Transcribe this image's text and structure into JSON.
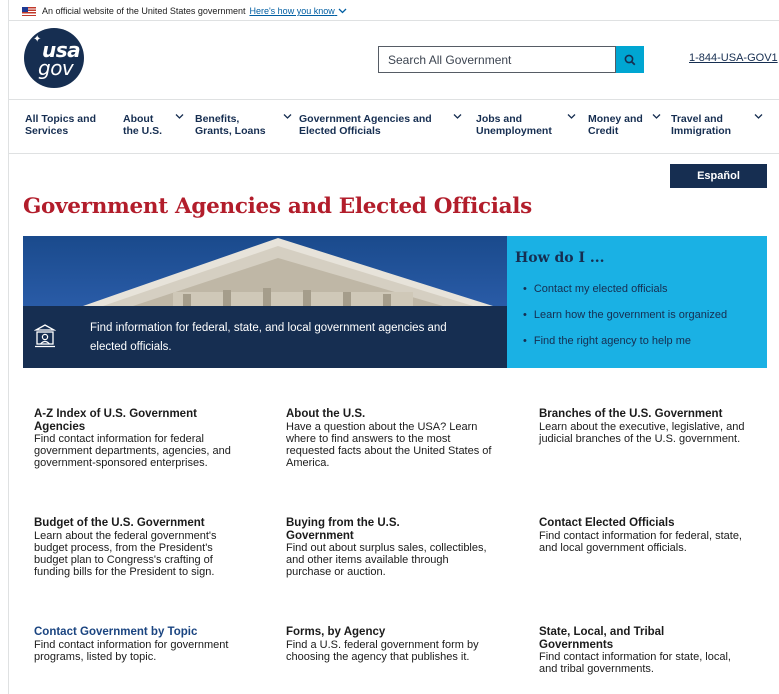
{
  "banner": {
    "official_text": "An official website of the United States government",
    "how_link": "Here's how you know"
  },
  "header": {
    "logo_top": "usa",
    "logo_bottom": "gov",
    "search_placeholder": "Search All Government",
    "phone": "1-844-USA-GOV1"
  },
  "nav": [
    {
      "line1": "All Topics and",
      "line2": "Services"
    },
    {
      "line1": "About",
      "line2": "the U.S."
    },
    {
      "line1": "Benefits,",
      "line2": "Grants, Loans"
    },
    {
      "line1": "Government Agencies and",
      "line2": "Elected Officials"
    },
    {
      "line1": "Jobs and",
      "line2": "Unemployment"
    },
    {
      "line1": "Money and",
      "line2": "Credit"
    },
    {
      "line1": "Travel and",
      "line2": "Immigration"
    }
  ],
  "language_button": "Español",
  "page_title": "Government Agencies and Elected Officials",
  "hero": {
    "caption": "Find information for federal, state, and local government agencies and elected officials."
  },
  "how_do_i": {
    "title": "How do I ...",
    "links": [
      "Contact my elected officials",
      "Learn how the government is organized",
      "Find the right agency to help me"
    ]
  },
  "cards": [
    {
      "title": "A-Z Index of U.S. Government Agencies",
      "desc": "Find contact information for federal government departments, agencies, and government-sponsored enterprises."
    },
    {
      "title": "About the U.S.",
      "desc": "Have a question about the USA? Learn where to find answers to the most requested facts about the United States of America."
    },
    {
      "title": "Branches of the U.S. Government",
      "desc": "Learn about the executive, legislative, and judicial branches of the U.S. government."
    },
    {
      "title": "Budget of the U.S. Government",
      "desc": "Learn about the federal government's budget process, from the President's budget plan to Congress's crafting of funding bills for the President to sign."
    },
    {
      "title": "Buying from the U.S. Government",
      "desc": "Find out about surplus sales, collectibles, and other items available through purchase or auction."
    },
    {
      "title": "Contact Elected Officials",
      "desc": "Find contact information for federal, state, and local government officials."
    },
    {
      "title": "Contact Government by Topic",
      "desc": "Find contact information for government programs, listed by topic."
    },
    {
      "title": "Forms, by Agency",
      "desc": "Find a U.S. federal government form by choosing the agency that publishes it."
    },
    {
      "title": "State, Local, and Tribal Governments",
      "desc": "Find contact information for state, local, and tribal governments."
    }
  ],
  "colors": {
    "navy": "#162e51",
    "title_red": "#b21d2b",
    "cyan": "#1ab1e4",
    "search_button": "#00a6d2",
    "link_blue": "#1a4480"
  }
}
